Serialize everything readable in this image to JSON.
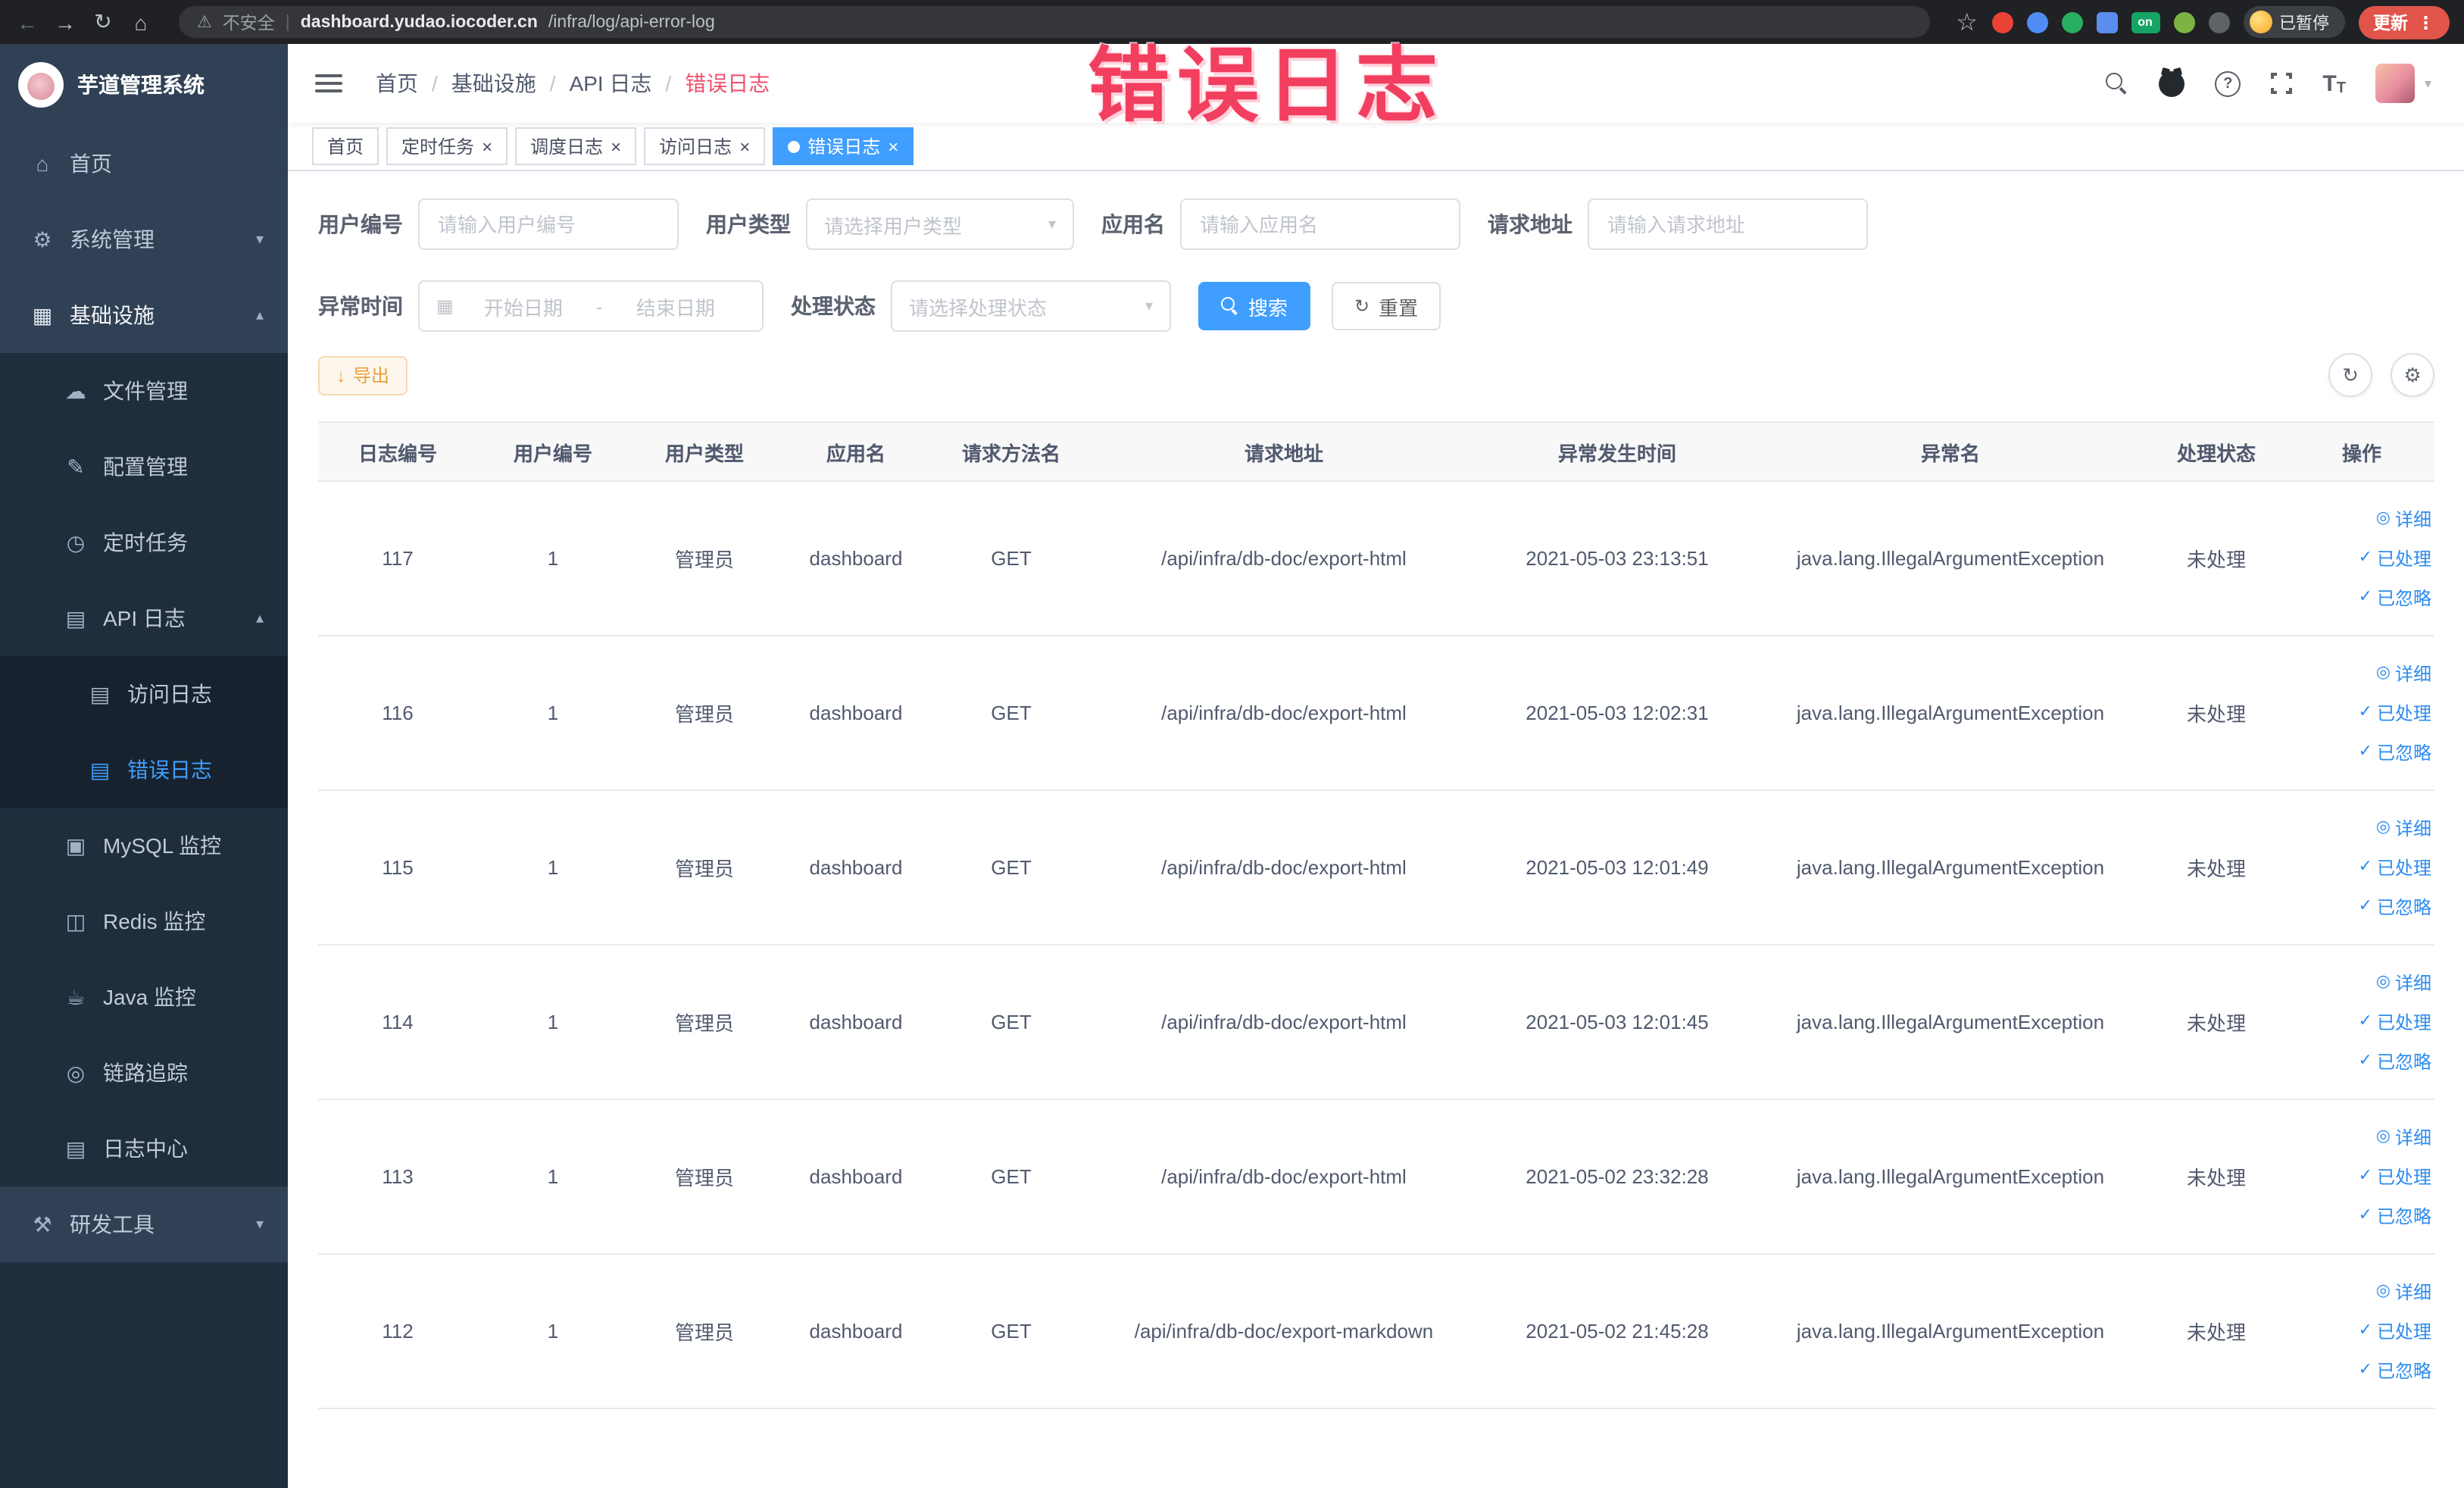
{
  "browser": {
    "security_label": "不安全",
    "url_domain": "dashboard.yudao.iocoder.cn",
    "url_path": "/infra/log/api-error-log",
    "profile_badge": "已暂停",
    "update_button": "更新"
  },
  "icons": {
    "back": "←",
    "forward": "→",
    "reload": "↻",
    "home": "⌂",
    "warning": "⚠",
    "star": "☆",
    "dots_vertical": "⋮",
    "url_divider": "|",
    "breadcrumb_separator": "/",
    "question": "?",
    "caret_down": "▾",
    "caret_up": "▴",
    "close": "×",
    "calendar": "▦",
    "range_separator": "-",
    "refresh": "↻",
    "gear": "⚙",
    "download": "↓",
    "check": "✓",
    "eye": "◎",
    "font_large": "T",
    "font_small": "T",
    "extension_on": "on"
  },
  "sidebar": {
    "logo_title": "芋道管理系统",
    "items": [
      {
        "label": "首页",
        "glyph": "⌂"
      },
      {
        "label": "系统管理",
        "glyph": "⚙"
      },
      {
        "label": "基础设施",
        "glyph": "▦"
      },
      {
        "label": "文件管理",
        "glyph": "☁"
      },
      {
        "label": "配置管理",
        "glyph": "✎"
      },
      {
        "label": "定时任务",
        "glyph": "◷"
      },
      {
        "label": "API 日志",
        "glyph": "▤"
      },
      {
        "label": "访问日志",
        "glyph": "▤"
      },
      {
        "label": "错误日志",
        "glyph": "▤"
      },
      {
        "label": "MySQL 监控",
        "glyph": "▣"
      },
      {
        "label": "Redis 监控",
        "glyph": "◫"
      },
      {
        "label": "Java 监控",
        "glyph": "☕"
      },
      {
        "label": "链路追踪",
        "glyph": "◎"
      },
      {
        "label": "日志中心",
        "glyph": "▤"
      },
      {
        "label": "研发工具",
        "glyph": "⚒"
      }
    ]
  },
  "header": {
    "breadcrumb": [
      "首页",
      "基础设施",
      "API 日志",
      "错误日志"
    ]
  },
  "tabs": [
    {
      "label": "首页"
    },
    {
      "label": "定时任务"
    },
    {
      "label": "调度日志"
    },
    {
      "label": "访问日志"
    },
    {
      "label": "错误日志"
    }
  ],
  "filters": {
    "user_id_label": "用户编号",
    "user_id_placeholder": "请输入用户编号",
    "user_type_label": "用户类型",
    "user_type_placeholder": "请选择用户类型",
    "app_name_label": "应用名",
    "app_name_placeholder": "请输入应用名",
    "request_url_label": "请求地址",
    "request_url_placeholder": "请输入请求地址",
    "exception_time_label": "异常时间",
    "start_date_placeholder": "开始日期",
    "end_date_placeholder": "结束日期",
    "process_status_label": "处理状态",
    "process_status_placeholder": "请选择处理状态",
    "search_label": "搜索",
    "reset_label": "重置"
  },
  "toolbar": {
    "export_label": "导出"
  },
  "table": {
    "headers": [
      "日志编号",
      "用户编号",
      "用户类型",
      "应用名",
      "请求方法名",
      "请求地址",
      "异常发生时间",
      "异常名",
      "处理状态",
      "操作"
    ],
    "actions": {
      "detail": "详细",
      "processed": "已处理",
      "ignored": "已忽略"
    },
    "rows": [
      {
        "log_id": "117",
        "user_id": "1",
        "user_type": "管理员",
        "app_name": "dashboard",
        "method": "GET",
        "url": "/api/infra/db-doc/export-html",
        "time": "2021-05-03 23:13:51",
        "exception": "java.lang.IllegalArgumentException",
        "status": "未处理"
      },
      {
        "log_id": "116",
        "user_id": "1",
        "user_type": "管理员",
        "app_name": "dashboard",
        "method": "GET",
        "url": "/api/infra/db-doc/export-html",
        "time": "2021-05-03 12:02:31",
        "exception": "java.lang.IllegalArgumentException",
        "status": "未处理"
      },
      {
        "log_id": "115",
        "user_id": "1",
        "user_type": "管理员",
        "app_name": "dashboard",
        "method": "GET",
        "url": "/api/infra/db-doc/export-html",
        "time": "2021-05-03 12:01:49",
        "exception": "java.lang.IllegalArgumentException",
        "status": "未处理"
      },
      {
        "log_id": "114",
        "user_id": "1",
        "user_type": "管理员",
        "app_name": "dashboard",
        "method": "GET",
        "url": "/api/infra/db-doc/export-html",
        "time": "2021-05-03 12:01:45",
        "exception": "java.lang.IllegalArgumentException",
        "status": "未处理"
      },
      {
        "log_id": "113",
        "user_id": "1",
        "user_type": "管理员",
        "app_name": "dashboard",
        "method": "GET",
        "url": "/api/infra/db-doc/export-html",
        "time": "2021-05-02 23:32:28",
        "exception": "java.lang.IllegalArgumentException",
        "status": "未处理"
      },
      {
        "log_id": "112",
        "user_id": "1",
        "user_type": "管理员",
        "app_name": "dashboard",
        "method": "GET",
        "url": "/api/infra/db-doc/export-markdown",
        "time": "2021-05-02 21:45:28",
        "exception": "java.lang.IllegalArgumentException",
        "status": "未处理"
      }
    ]
  },
  "annotation": {
    "text": "错误日志"
  }
}
